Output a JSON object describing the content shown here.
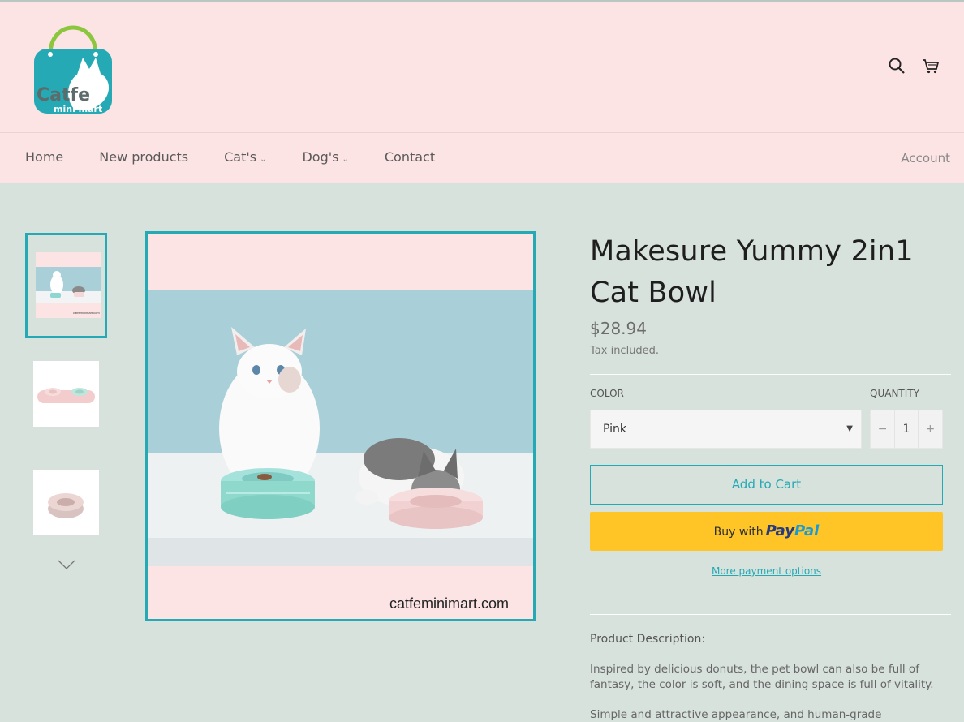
{
  "brand": {
    "logo_line1": "Catfe",
    "logo_line2": "mini mart",
    "accent": "#24a9b5",
    "header_bg": "#fde4e4",
    "page_bg": "#d8e2dc"
  },
  "header": {
    "icons": [
      "search-icon",
      "cart-icon"
    ]
  },
  "nav": {
    "items": [
      {
        "label": "Home",
        "dropdown": false
      },
      {
        "label": "New products",
        "dropdown": false
      },
      {
        "label": "Cat's",
        "dropdown": true
      },
      {
        "label": "Dog's",
        "dropdown": true
      },
      {
        "label": "Contact",
        "dropdown": false
      }
    ],
    "account": "Account"
  },
  "gallery": {
    "thumbnails": [
      "two cats with bowls",
      "pink and teal double bowl",
      "pink donut bowl"
    ],
    "active_index": 0,
    "main_watermark": "catfeminimart.com",
    "thumb_watermark": "catfeminimart.com"
  },
  "product": {
    "title": "Makesure Yummy 2in1 Cat Bowl",
    "price": "$28.94",
    "tax_note": "Tax included.",
    "color_label": "COLOR",
    "color_value": "Pink",
    "quantity_label": "QUANTITY",
    "quantity_minus": "−",
    "quantity_value": "1",
    "quantity_plus": "+",
    "add_to_cart": "Add to Cart",
    "paypal_prefix": "Buy with",
    "paypal_brand_1": "Pay",
    "paypal_brand_2": "Pal",
    "paypal_color": "#ffc526",
    "more_payment": "More payment options",
    "description_heading": "Product Description:",
    "description_p1": "Inspired by delicious donuts, the pet bowl can also be full of fantasy, the color is soft, and the dining space is full of vitality.",
    "description_p2": "Simple and attractive appearance, and human-grade"
  }
}
